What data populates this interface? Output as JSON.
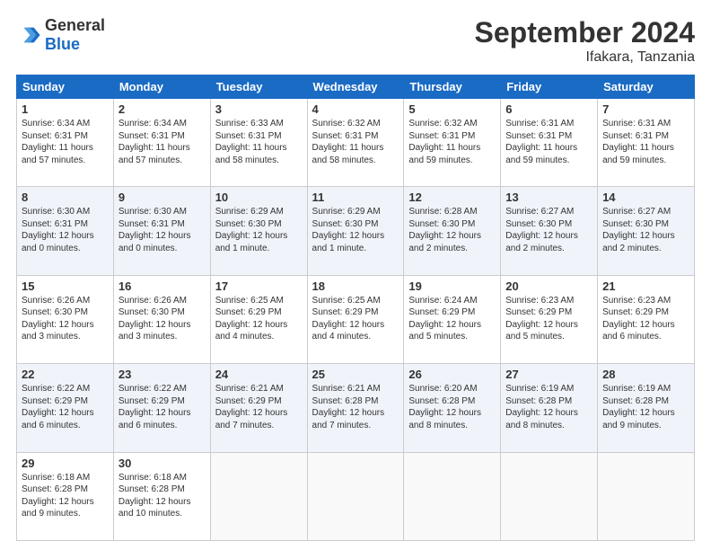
{
  "logo": {
    "general": "General",
    "blue": "Blue"
  },
  "header": {
    "month": "September 2024",
    "location": "Ifakara, Tanzania"
  },
  "weekdays": [
    "Sunday",
    "Monday",
    "Tuesday",
    "Wednesday",
    "Thursday",
    "Friday",
    "Saturday"
  ],
  "weeks": [
    [
      {
        "day": "1",
        "sunrise": "6:34 AM",
        "sunset": "6:31 PM",
        "daylight": "11 hours and 57 minutes."
      },
      {
        "day": "2",
        "sunrise": "6:34 AM",
        "sunset": "6:31 PM",
        "daylight": "11 hours and 57 minutes."
      },
      {
        "day": "3",
        "sunrise": "6:33 AM",
        "sunset": "6:31 PM",
        "daylight": "11 hours and 58 minutes."
      },
      {
        "day": "4",
        "sunrise": "6:32 AM",
        "sunset": "6:31 PM",
        "daylight": "11 hours and 58 minutes."
      },
      {
        "day": "5",
        "sunrise": "6:32 AM",
        "sunset": "6:31 PM",
        "daylight": "11 hours and 59 minutes."
      },
      {
        "day": "6",
        "sunrise": "6:31 AM",
        "sunset": "6:31 PM",
        "daylight": "11 hours and 59 minutes."
      },
      {
        "day": "7",
        "sunrise": "6:31 AM",
        "sunset": "6:31 PM",
        "daylight": "11 hours and 59 minutes."
      }
    ],
    [
      {
        "day": "8",
        "sunrise": "6:30 AM",
        "sunset": "6:31 PM",
        "daylight": "12 hours and 0 minutes."
      },
      {
        "day": "9",
        "sunrise": "6:30 AM",
        "sunset": "6:31 PM",
        "daylight": "12 hours and 0 minutes."
      },
      {
        "day": "10",
        "sunrise": "6:29 AM",
        "sunset": "6:30 PM",
        "daylight": "12 hours and 1 minute."
      },
      {
        "day": "11",
        "sunrise": "6:29 AM",
        "sunset": "6:30 PM",
        "daylight": "12 hours and 1 minute."
      },
      {
        "day": "12",
        "sunrise": "6:28 AM",
        "sunset": "6:30 PM",
        "daylight": "12 hours and 2 minutes."
      },
      {
        "day": "13",
        "sunrise": "6:27 AM",
        "sunset": "6:30 PM",
        "daylight": "12 hours and 2 minutes."
      },
      {
        "day": "14",
        "sunrise": "6:27 AM",
        "sunset": "6:30 PM",
        "daylight": "12 hours and 2 minutes."
      }
    ],
    [
      {
        "day": "15",
        "sunrise": "6:26 AM",
        "sunset": "6:30 PM",
        "daylight": "12 hours and 3 minutes."
      },
      {
        "day": "16",
        "sunrise": "6:26 AM",
        "sunset": "6:30 PM",
        "daylight": "12 hours and 3 minutes."
      },
      {
        "day": "17",
        "sunrise": "6:25 AM",
        "sunset": "6:29 PM",
        "daylight": "12 hours and 4 minutes."
      },
      {
        "day": "18",
        "sunrise": "6:25 AM",
        "sunset": "6:29 PM",
        "daylight": "12 hours and 4 minutes."
      },
      {
        "day": "19",
        "sunrise": "6:24 AM",
        "sunset": "6:29 PM",
        "daylight": "12 hours and 5 minutes."
      },
      {
        "day": "20",
        "sunrise": "6:23 AM",
        "sunset": "6:29 PM",
        "daylight": "12 hours and 5 minutes."
      },
      {
        "day": "21",
        "sunrise": "6:23 AM",
        "sunset": "6:29 PM",
        "daylight": "12 hours and 6 minutes."
      }
    ],
    [
      {
        "day": "22",
        "sunrise": "6:22 AM",
        "sunset": "6:29 PM",
        "daylight": "12 hours and 6 minutes."
      },
      {
        "day": "23",
        "sunrise": "6:22 AM",
        "sunset": "6:29 PM",
        "daylight": "12 hours and 6 minutes."
      },
      {
        "day": "24",
        "sunrise": "6:21 AM",
        "sunset": "6:29 PM",
        "daylight": "12 hours and 7 minutes."
      },
      {
        "day": "25",
        "sunrise": "6:21 AM",
        "sunset": "6:28 PM",
        "daylight": "12 hours and 7 minutes."
      },
      {
        "day": "26",
        "sunrise": "6:20 AM",
        "sunset": "6:28 PM",
        "daylight": "12 hours and 8 minutes."
      },
      {
        "day": "27",
        "sunrise": "6:19 AM",
        "sunset": "6:28 PM",
        "daylight": "12 hours and 8 minutes."
      },
      {
        "day": "28",
        "sunrise": "6:19 AM",
        "sunset": "6:28 PM",
        "daylight": "12 hours and 9 minutes."
      }
    ],
    [
      {
        "day": "29",
        "sunrise": "6:18 AM",
        "sunset": "6:28 PM",
        "daylight": "12 hours and 9 minutes."
      },
      {
        "day": "30",
        "sunrise": "6:18 AM",
        "sunset": "6:28 PM",
        "daylight": "12 hours and 10 minutes."
      },
      null,
      null,
      null,
      null,
      null
    ]
  ]
}
